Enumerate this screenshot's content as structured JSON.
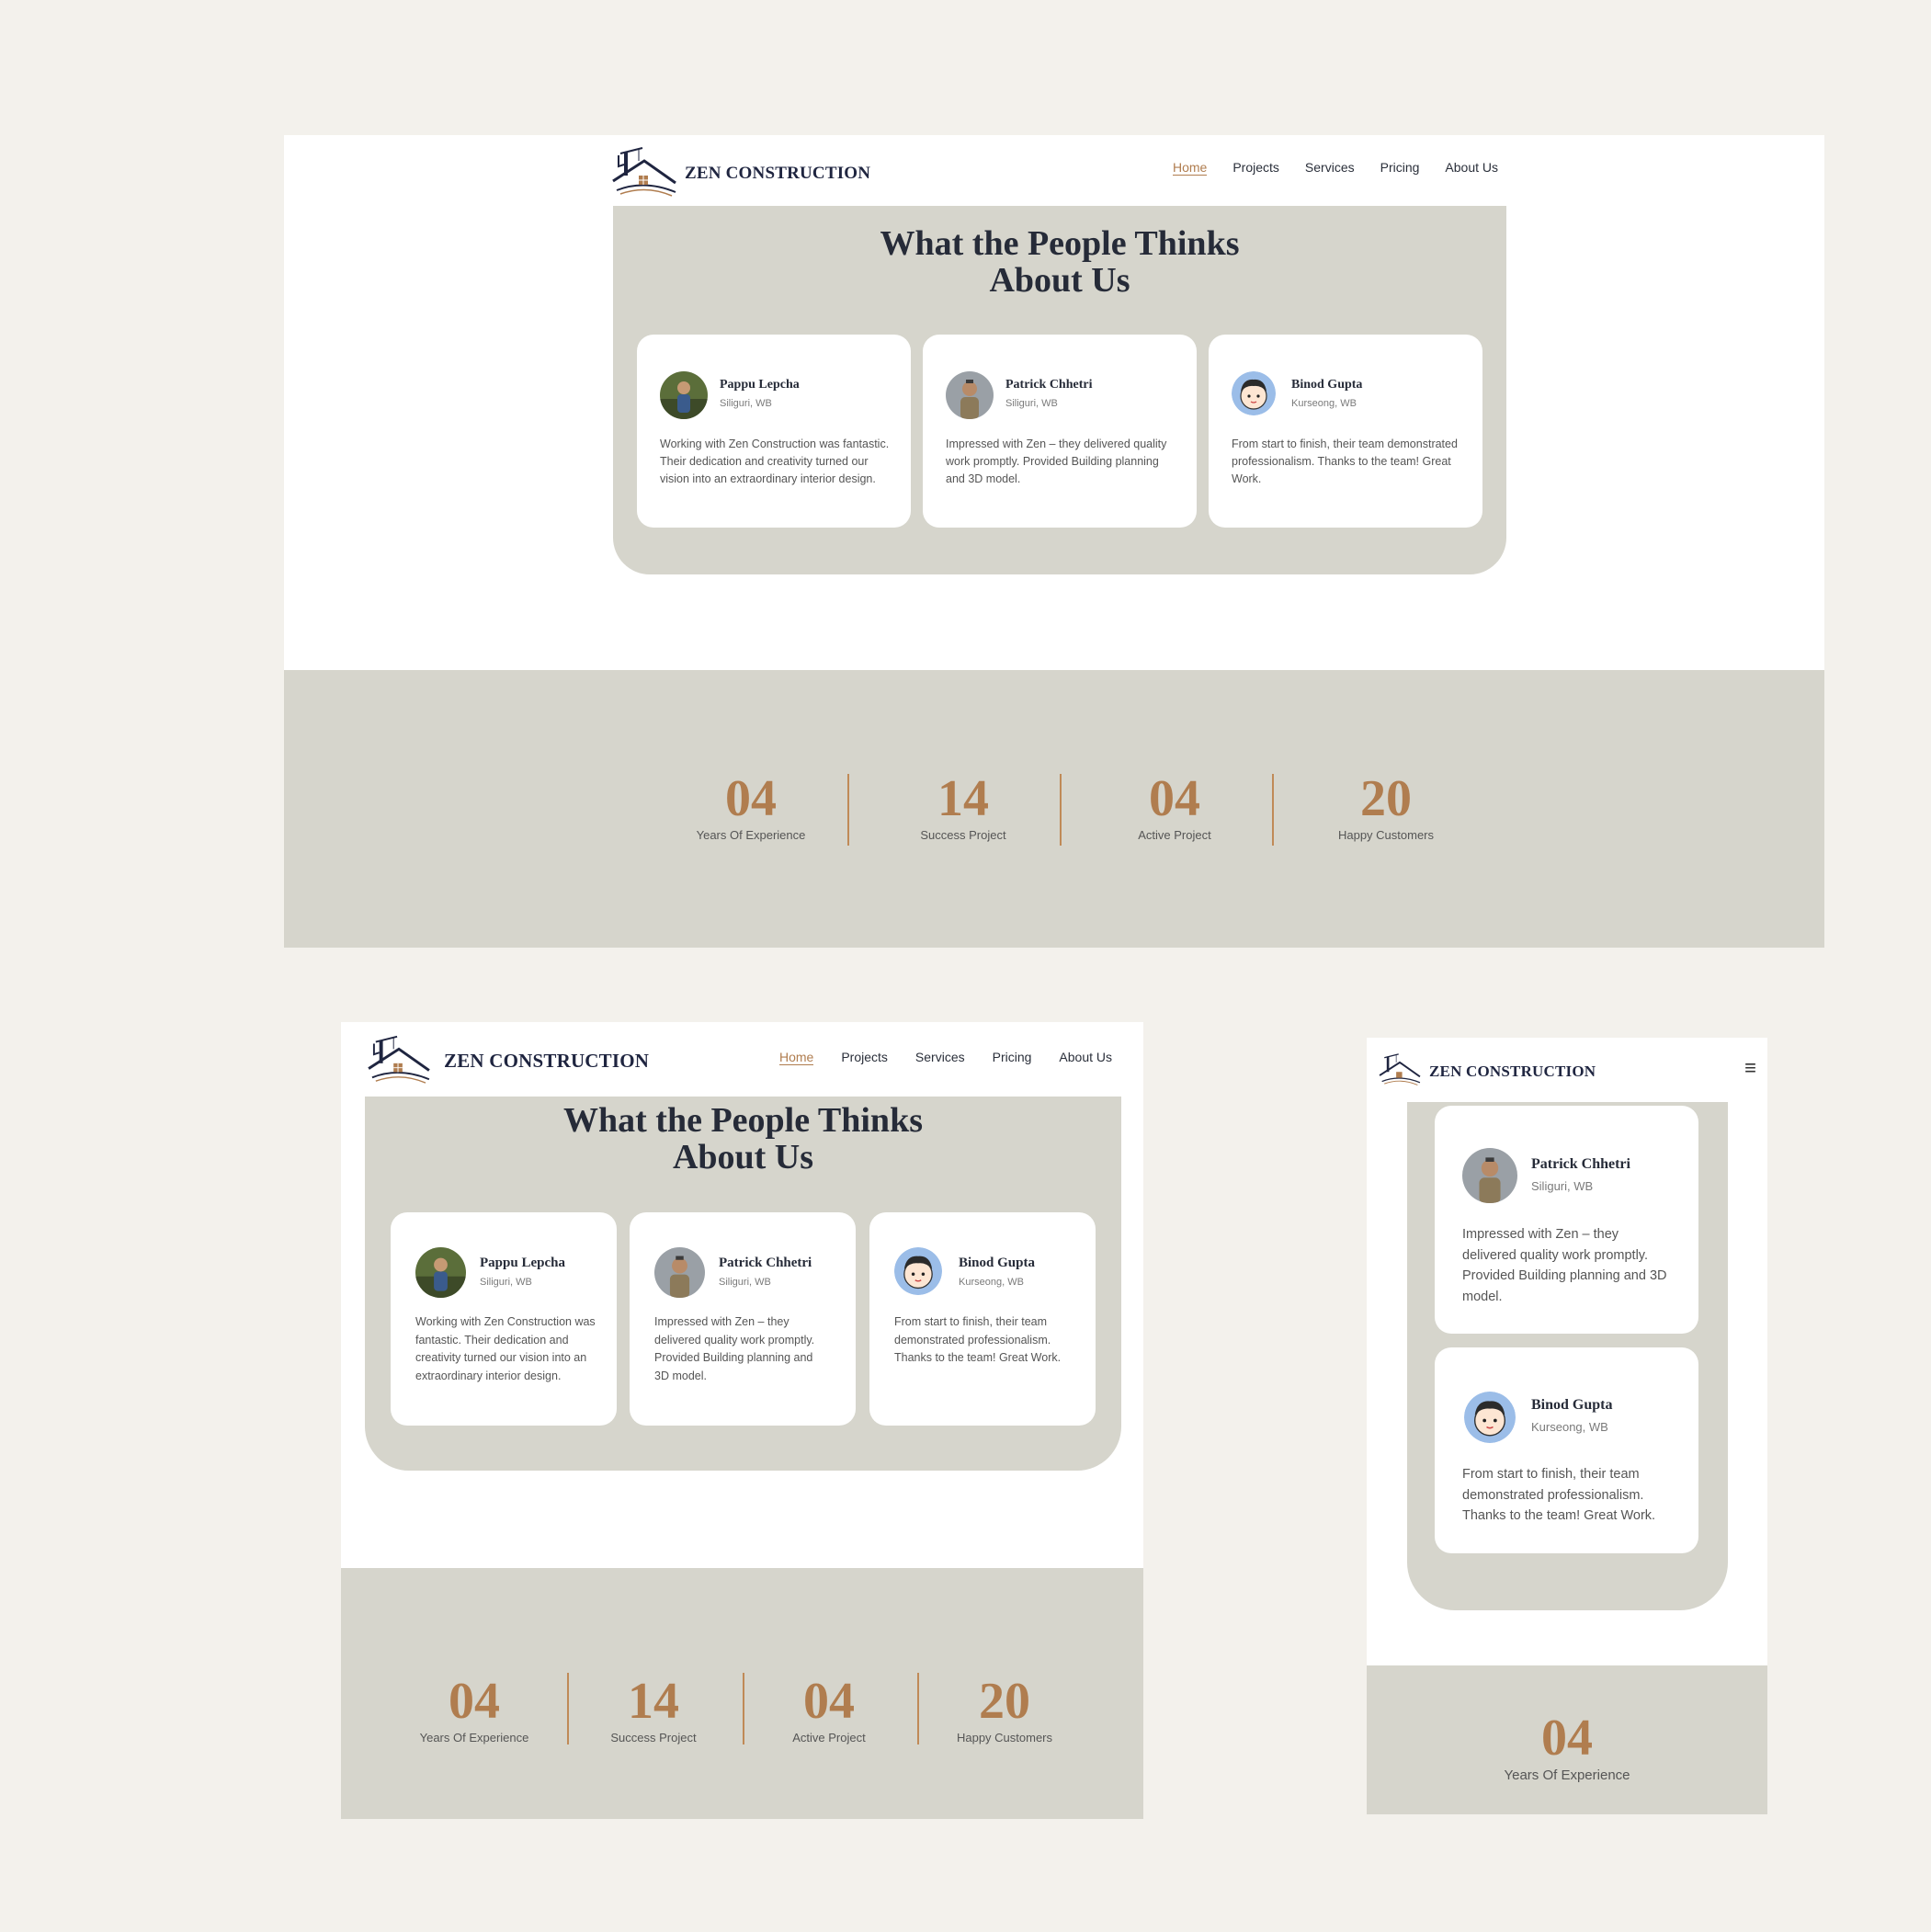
{
  "site": {
    "logo_text": "ZEN CONSTRUCTION",
    "logo_icon": "house-crane-logo",
    "menu_icon": "hamburger-menu-icon",
    "menu_glyph": "≡"
  },
  "nav": {
    "home": "Home",
    "projects": "Projects",
    "services": "Services",
    "pricing": "Pricing",
    "about": "About Us"
  },
  "testimonials": {
    "title_line1": "What the People Thinks",
    "title_line2": "About Us",
    "items": [
      {
        "name": "Pappu Lepcha",
        "location": "Siliguri, WB",
        "text": "Working with Zen Construction was fantastic. Their dedication and creativity turned our vision into an extraordinary interior design.",
        "avatar": "photo-avatar-outdoor"
      },
      {
        "name": "Patrick Chhetri",
        "location": "Siliguri, WB",
        "text": "Impressed with Zen – they delivered quality work promptly. Provided Building planning and 3D model.",
        "avatar": "photo-avatar-uniform"
      },
      {
        "name": "Binod Gupta",
        "location": "Kurseong, WB",
        "text": "From start to finish, their team demonstrated professionalism. Thanks to the team! Great Work.",
        "avatar": "cartoon-boy-avatar"
      }
    ]
  },
  "stats": [
    {
      "value": "04",
      "label": "Years Of Experience"
    },
    {
      "value": "14",
      "label": "Success Project"
    },
    {
      "value": "04",
      "label": "Active Project"
    },
    {
      "value": "20",
      "label": "Happy Customers"
    }
  ],
  "colors": {
    "page_bg": "#f3f1ec",
    "section_bg": "#d6d5cc",
    "accent": "#b07d4f",
    "heading": "#262b38"
  }
}
